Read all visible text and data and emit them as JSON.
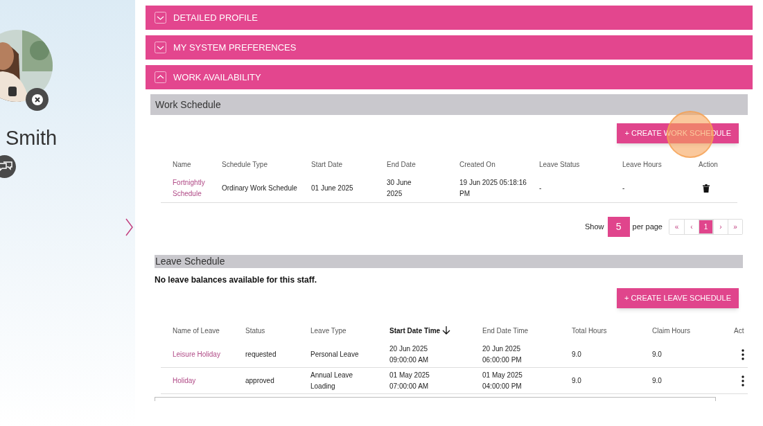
{
  "profile": {
    "name": "Smith"
  },
  "accordions": [
    {
      "title": "DETAILED PROFILE",
      "expanded": false
    },
    {
      "title": "MY SYSTEM PREFERENCES",
      "expanded": false
    },
    {
      "title": "WORK AVAILABILITY",
      "expanded": true
    }
  ],
  "work_schedule": {
    "title": "Work Schedule",
    "button": "+ CREATE WORK SCHEDULE",
    "columns": [
      "Name",
      "Schedule Type",
      "Start Date",
      "End Date",
      "Created On",
      "Leave Status",
      "Leave Hours",
      "Action"
    ],
    "rows": [
      {
        "name": "Fortnightly Schedule",
        "schedule_type": "Ordinary Work Schedule",
        "start_date": "01 June 2025",
        "end_date": "30 June 2025",
        "created_on": "19 Jun 2025 05:18:16 PM",
        "leave_status": "-",
        "leave_hours": "-"
      }
    ],
    "pagination": {
      "show": "Show",
      "page_size": "5",
      "per_page": "per page",
      "buttons": [
        {
          "label": "«",
          "selected": false
        },
        {
          "label": "‹",
          "selected": false
        },
        {
          "label": "1",
          "selected": true
        },
        {
          "label": "›",
          "selected": false
        },
        {
          "label": "»",
          "selected": false
        }
      ]
    }
  },
  "leave_schedule": {
    "title": "Leave Schedule",
    "message": "No leave balances available for this staff.",
    "button": "+ CREATE LEAVE SCHEDULE",
    "columns": [
      {
        "label": "Name of Leave",
        "sorted": false
      },
      {
        "label": "Status",
        "sorted": false
      },
      {
        "label": "Leave Type",
        "sorted": false
      },
      {
        "label": "Start Date Time",
        "sorted": true
      },
      {
        "label": "End Date Time",
        "sorted": false
      },
      {
        "label": "Total Hours",
        "sorted": false
      },
      {
        "label": "Claim Hours",
        "sorted": false
      },
      {
        "label": "Act",
        "sorted": false
      }
    ],
    "rows": [
      {
        "name": "Leisure Holiday",
        "status": "requested",
        "leave_type": "Personal Leave",
        "start": "20 Jun 2025 09:00:00 AM",
        "end": "20 Jun 2025 06:00:00 PM",
        "total_hours": "9.0",
        "claim_hours": "9.0"
      },
      {
        "name": "Holiday",
        "status": "approved",
        "leave_type": "Annual Leave Loading",
        "start": "01 May 2025 07:00:00 AM",
        "end": "01 May 2025 04:00:00 PM",
        "total_hours": "9.0",
        "claim_hours": "9.0"
      }
    ]
  }
}
